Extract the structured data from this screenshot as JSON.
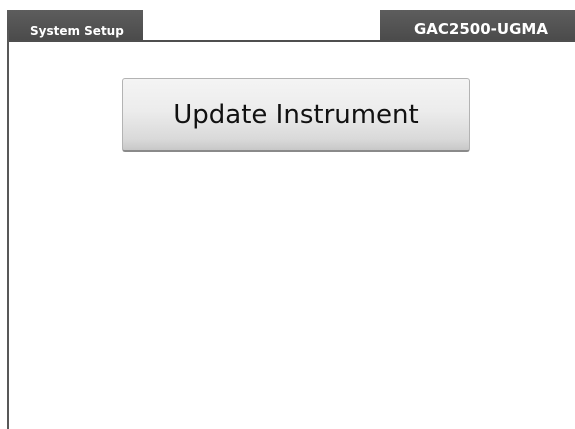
{
  "header": {
    "title": "System Setup",
    "device_id": "GAC2500-UGMA"
  },
  "main": {
    "update_button_label": "Update Instrument"
  },
  "colors": {
    "title_bar": "#555555",
    "title_text": "#ffffff",
    "background": "#ffffff"
  }
}
